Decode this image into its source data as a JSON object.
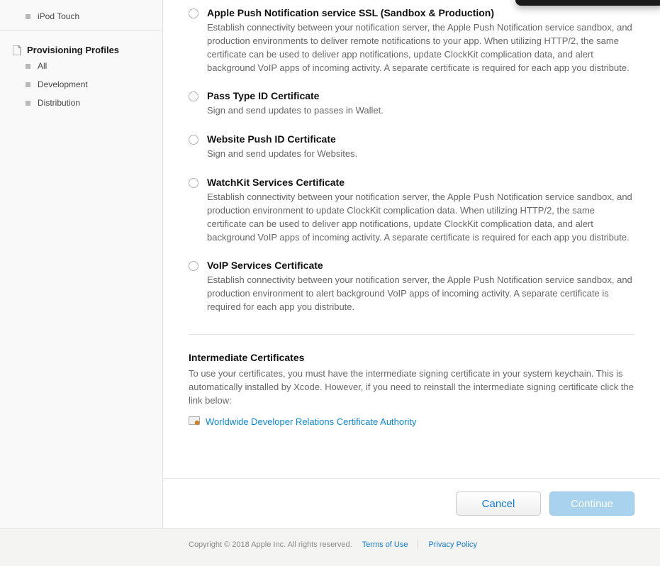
{
  "sidebar": {
    "top_item": "iPod Touch",
    "section_title": "Provisioning Profiles",
    "sub_items": [
      "All",
      "Development",
      "Distribution"
    ]
  },
  "options": [
    {
      "title": "Apple Push Notification service SSL (Sandbox & Production)",
      "desc": "Establish connectivity between your notification server, the Apple Push Notification service sandbox, and production environments to deliver remote notifications to your app. When utilizing HTTP/2, the same certificate can be used to deliver app notifications, update ClockKit complication data, and alert background VoIP apps of incoming activity. A separate certificate is required for each app you distribute."
    },
    {
      "title": "Pass Type ID Certificate",
      "desc": "Sign and send updates to passes in Wallet."
    },
    {
      "title": "Website Push ID Certificate",
      "desc": "Sign and send updates for Websites."
    },
    {
      "title": "WatchKit Services Certificate",
      "desc": "Establish connectivity between your notification server, the Apple Push Notification service sandbox, and production environment to update ClockKit complication data. When utilizing HTTP/2, the same certificate can be used to deliver app notifications, update ClockKit complication data, and alert background VoIP apps of incoming activity. A separate certificate is required for each app you distribute."
    },
    {
      "title": "VoIP Services Certificate",
      "desc": "Establish connectivity between your notification server, the Apple Push Notification service sandbox, and production environment to alert background VoIP apps of incoming activity. A separate certificate is required for each app you distribute."
    }
  ],
  "intermediate": {
    "title": "Intermediate Certificates",
    "desc": "To use your certificates, you must have the intermediate signing certificate in your system keychain. This is automatically installed by Xcode. However, if you need to reinstall the intermediate signing certificate click the link below:",
    "link_label": "Worldwide Developer Relations Certificate Authority"
  },
  "buttons": {
    "cancel": "Cancel",
    "continue": "Continue"
  },
  "footer": {
    "copyright": "Copyright © 2018 Apple Inc. All rights reserved.",
    "terms": "Terms of Use",
    "privacy": "Privacy Policy"
  }
}
